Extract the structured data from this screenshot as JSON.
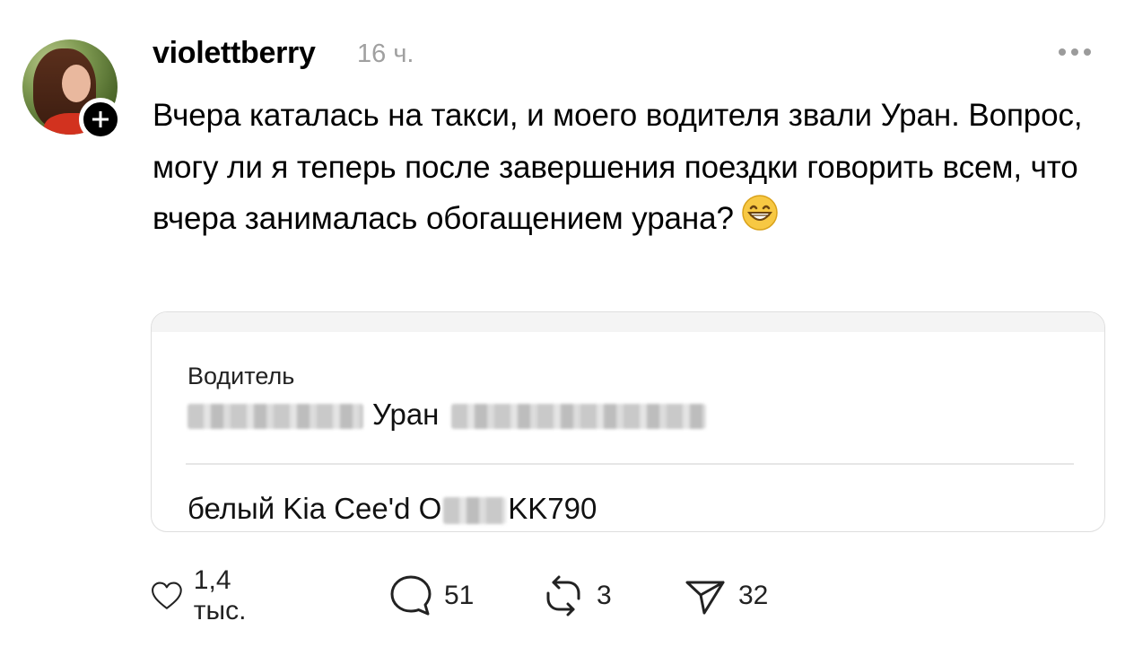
{
  "post": {
    "username": "violettberry",
    "time": "16 ч.",
    "text": "Вчера каталась на такси, и моего водителя звали Уран. Вопрос, могу ли я теперь после завершения поездки говорить всем, что вчера занималась обогащением урана?",
    "emoji": "grinning-face-emoji"
  },
  "card": {
    "label": "Водитель",
    "driver_name": "Уран",
    "car_prefix": "белый Kia Cee'd O",
    "car_suffix": "KK790"
  },
  "actions": {
    "likes": "1,4 тыс.",
    "comments": "51",
    "reposts": "3",
    "shares": "32"
  },
  "icons": {
    "more": "more-dots-icon",
    "like": "heart-icon",
    "comment": "comment-bubble-icon",
    "repost": "repost-icon",
    "share": "send-icon",
    "follow": "plus-icon"
  }
}
